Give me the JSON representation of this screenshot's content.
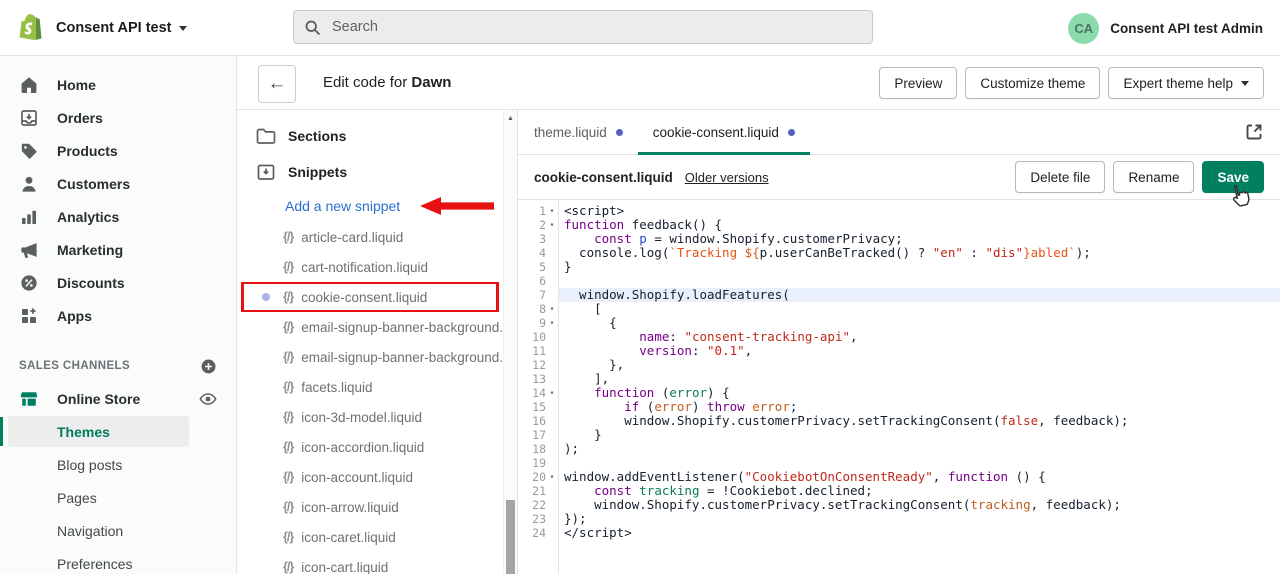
{
  "topbar": {
    "store_name": "Consent API test",
    "search_placeholder": "Search",
    "avatar_initials": "CA",
    "account_name": "Consent API test Admin"
  },
  "sidebar": {
    "items": [
      {
        "label": "Home",
        "icon": "home-icon"
      },
      {
        "label": "Orders",
        "icon": "orders-icon"
      },
      {
        "label": "Products",
        "icon": "products-icon"
      },
      {
        "label": "Customers",
        "icon": "customers-icon"
      },
      {
        "label": "Analytics",
        "icon": "analytics-icon"
      },
      {
        "label": "Marketing",
        "icon": "marketing-icon"
      },
      {
        "label": "Discounts",
        "icon": "discounts-icon"
      },
      {
        "label": "Apps",
        "icon": "apps-icon"
      }
    ],
    "sales_channels_label": "SALES CHANNELS",
    "online_store": {
      "label": "Online Store",
      "sub_items": [
        {
          "label": "Themes",
          "selected": true
        },
        {
          "label": "Blog posts",
          "selected": false
        },
        {
          "label": "Pages",
          "selected": false
        },
        {
          "label": "Navigation",
          "selected": false
        },
        {
          "label": "Preferences",
          "selected": false
        }
      ]
    }
  },
  "header": {
    "title_prefix": "Edit code for ",
    "theme_name": "Dawn",
    "buttons": [
      "Preview",
      "Customize theme",
      "Expert theme help"
    ]
  },
  "filetree": {
    "sections_label": "Sections",
    "snippets_label": "Snippets",
    "add_link": "Add a new snippet",
    "highlighted_file": "cookie-consent.liquid",
    "files": [
      "article-card.liquid",
      "cart-notification.liquid",
      "cookie-consent.liquid",
      "email-signup-banner-background.liquid",
      "email-signup-banner-background.liquid",
      "facets.liquid",
      "icon-3d-model.liquid",
      "icon-accordion.liquid",
      "icon-account.liquid",
      "icon-arrow.liquid",
      "icon-caret.liquid",
      "icon-cart.liquid"
    ]
  },
  "editor": {
    "tabs": [
      {
        "label": "theme.liquid",
        "active": false
      },
      {
        "label": "cookie-consent.liquid",
        "active": true
      }
    ],
    "file_name": "cookie-consent.liquid",
    "older_versions_label": "Older versions",
    "buttons": {
      "delete": "Delete file",
      "rename": "Rename",
      "save": "Save"
    },
    "code": {
      "lines": [
        {
          "n": 1,
          "f": 1,
          "s": [
            [
              "d",
              "<script>"
            ]
          ]
        },
        {
          "n": 2,
          "f": 1,
          "s": [
            [
              "k",
              "function"
            ],
            [
              "d",
              " feedback() {"
            ]
          ]
        },
        {
          "n": 3,
          "s": [
            [
              "d",
              "    "
            ],
            [
              "k",
              "const"
            ],
            [
              "d",
              " "
            ],
            [
              "v",
              "p"
            ],
            [
              "d",
              " = window.Shopify.customerPrivacy;"
            ]
          ]
        },
        {
          "n": 4,
          "s": [
            [
              "d",
              "  console.log("
            ],
            [
              "t",
              "`Tracking ${"
            ],
            [
              "d",
              "p.userCanBeTracked() ? "
            ],
            [
              "s",
              "\"en\""
            ],
            [
              "d",
              " : "
            ],
            [
              "s",
              "\"dis\""
            ],
            [
              "t",
              "}abled`"
            ],
            [
              "d",
              ");"
            ]
          ]
        },
        {
          "n": 5,
          "s": [
            [
              "d",
              "}"
            ]
          ]
        },
        {
          "n": 6,
          "s": []
        },
        {
          "n": 7,
          "a": 1,
          "s": [
            [
              "d",
              "  window.Shopify.loadFeatures("
            ]
          ]
        },
        {
          "n": 8,
          "f": 1,
          "s": [
            [
              "d",
              "    ["
            ]
          ]
        },
        {
          "n": 9,
          "f": 1,
          "s": [
            [
              "d",
              "      {"
            ]
          ]
        },
        {
          "n": 10,
          "s": [
            [
              "d",
              "          "
            ],
            [
              "k",
              "name"
            ],
            [
              "d",
              ": "
            ],
            [
              "s",
              "\"consent-tracking-api\""
            ],
            [
              "d",
              ","
            ]
          ]
        },
        {
          "n": 11,
          "s": [
            [
              "d",
              "          "
            ],
            [
              "k",
              "version"
            ],
            [
              "d",
              ": "
            ],
            [
              "s",
              "\"0.1\""
            ],
            [
              "d",
              ","
            ]
          ]
        },
        {
          "n": 12,
          "s": [
            [
              "d",
              "      },"
            ]
          ]
        },
        {
          "n": 13,
          "s": [
            [
              "d",
              "    ],"
            ]
          ]
        },
        {
          "n": 14,
          "f": 1,
          "s": [
            [
              "d",
              "    "
            ],
            [
              "k",
              "function"
            ],
            [
              "d",
              " ("
            ],
            [
              "g",
              "error"
            ],
            [
              "d",
              ") {"
            ]
          ]
        },
        {
          "n": 15,
          "s": [
            [
              "d",
              "        "
            ],
            [
              "k",
              "if"
            ],
            [
              "d",
              " ("
            ],
            [
              "o",
              "error"
            ],
            [
              "d",
              ") "
            ],
            [
              "k",
              "throw"
            ],
            [
              "d",
              " "
            ],
            [
              "o",
              "error"
            ],
            [
              "d",
              ";"
            ]
          ]
        },
        {
          "n": 16,
          "s": [
            [
              "d",
              "        window.Shopify.customerPrivacy.setTrackingConsent("
            ],
            [
              "s",
              "false"
            ],
            [
              "d",
              ", feedback);"
            ]
          ]
        },
        {
          "n": 17,
          "s": [
            [
              "d",
              "    }"
            ]
          ]
        },
        {
          "n": 18,
          "s": [
            [
              "d",
              ");"
            ]
          ]
        },
        {
          "n": 19,
          "s": []
        },
        {
          "n": 20,
          "f": 1,
          "s": [
            [
              "d",
              "window.addEventListener("
            ],
            [
              "s",
              "\"CookiebotOnConsentReady\""
            ],
            [
              "d",
              ", "
            ],
            [
              "k",
              "function"
            ],
            [
              "d",
              " () {"
            ]
          ]
        },
        {
          "n": 21,
          "s": [
            [
              "d",
              "    "
            ],
            [
              "k",
              "const"
            ],
            [
              "d",
              " "
            ],
            [
              "g",
              "tracking"
            ],
            [
              "d",
              " = !Cookiebot.declined;"
            ]
          ]
        },
        {
          "n": 22,
          "s": [
            [
              "d",
              "    window.Shopify.customerPrivacy.setTrackingConsent("
            ],
            [
              "o",
              "tracking"
            ],
            [
              "d",
              ", feedback);"
            ]
          ]
        },
        {
          "n": 23,
          "s": [
            [
              "d",
              "});"
            ]
          ]
        },
        {
          "n": 24,
          "s": [
            [
              "d",
              "</script>"
            ]
          ]
        }
      ]
    }
  },
  "colors": {
    "brand_green": "#00805f",
    "annotation_red": "#e81111",
    "tab_dot_indigo": "#5361c2",
    "keyword_purple": "#770088",
    "string_red": "#c0281c",
    "template_orange": "#e5541b"
  }
}
